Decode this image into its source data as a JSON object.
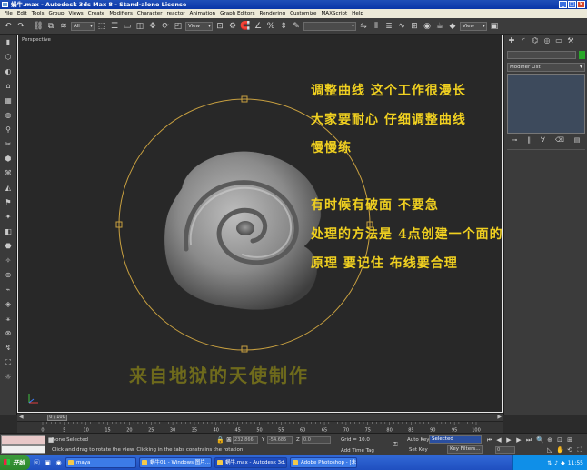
{
  "window": {
    "title": "蜗牛.max - Autodesk 3ds Max 8 - Stand-alone License"
  },
  "menu": [
    "File",
    "Edit",
    "Tools",
    "Group",
    "Views",
    "Create",
    "Modifiers",
    "Character",
    "reactor",
    "Animation",
    "Graph Editors",
    "Rendering",
    "Customize",
    "MAXScript",
    "Help"
  ],
  "toolbar": {
    "selection_filter": "All",
    "ref_coord": "View",
    "named_selection": "",
    "render_type": "View"
  },
  "viewport": {
    "label": "Perspective",
    "notes_top": [
      "调整曲线 这个工作很漫长",
      "大家要耐心 仔细调整曲线",
      "慢慢练"
    ],
    "notes_bottom": [
      "有时候有破面 不要急",
      "处理的方法是 4点创建一个面的",
      "原理   要记住  布线要合理"
    ],
    "watermark": "来自地狱的天使制作"
  },
  "command_panel": {
    "modifier_list": "Modifier List"
  },
  "timeline": {
    "slider": "0 / 100",
    "ticks": [
      "0",
      "5",
      "10",
      "15",
      "20",
      "25",
      "30",
      "35",
      "40",
      "45",
      "50",
      "55",
      "60",
      "65",
      "70",
      "75",
      "80",
      "85",
      "90",
      "95",
      "100"
    ]
  },
  "status": {
    "selection": "None Selected",
    "prompt": "Click and drag to rotate the view.  Clicking in the tabs constrains the rotation",
    "x_label": "X",
    "x_value": "232.866",
    "y_label": "Y",
    "y_value": "-54.685",
    "z_label": "Z",
    "z_value": "0.0",
    "grid": "Grid = 10.0",
    "add_time_tag": "Add Time Tag",
    "auto_key": "Auto Key",
    "set_key": "Set Key",
    "selected": "Selected",
    "key_filters": "Key Filters...",
    "frame": "0"
  },
  "taskbar": {
    "start": "开始",
    "tasks": [
      "maya",
      "蜗牛01 - Windows 图片...",
      "蜗牛.max - Autodesk 3d...",
      "Adobe Photoshop - [未..."
    ],
    "clock": "11:55"
  },
  "colors": {
    "curve": "#c8a040",
    "note_text": "#f0d020",
    "watermark": "#6e6a1c",
    "viewport_bg": "#282828"
  }
}
